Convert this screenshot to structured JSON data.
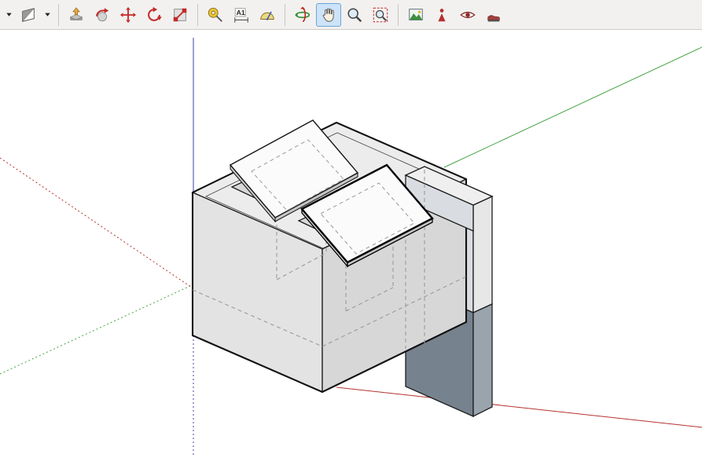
{
  "app": {
    "name": "SketchUp model window",
    "active_tool": "Pan"
  },
  "toolbar": {
    "background": "#f2f1ef",
    "dimensions_label": "A1",
    "buttons": [
      {
        "name": "style-dropdown",
        "icon": "dropdown-arrow-icon",
        "selected": false
      },
      {
        "name": "face-style",
        "icon": "face-style-swatch-icon",
        "selected": false
      },
      {
        "name": "face-style-dropdown",
        "icon": "dropdown-arrow-icon",
        "selected": false
      },
      {
        "name": "push-pull",
        "icon": "push-pull-icon",
        "selected": false
      },
      {
        "name": "follow-me",
        "icon": "follow-me-icon",
        "selected": false
      },
      {
        "name": "move",
        "icon": "move-icon",
        "selected": false
      },
      {
        "name": "rotate",
        "icon": "rotate-icon",
        "selected": false
      },
      {
        "name": "scale",
        "icon": "scale-icon",
        "selected": false
      },
      {
        "name": "tape-measure",
        "icon": "tape-measure-icon",
        "selected": false
      },
      {
        "name": "dimensions",
        "icon": "dimensions-icon",
        "selected": false,
        "label": "A1"
      },
      {
        "name": "protractor",
        "icon": "protractor-icon",
        "selected": false
      },
      {
        "name": "orbit",
        "icon": "orbit-icon",
        "selected": false
      },
      {
        "name": "pan",
        "icon": "pan-hand-icon",
        "selected": true
      },
      {
        "name": "zoom",
        "icon": "zoom-icon",
        "selected": false
      },
      {
        "name": "zoom-extents",
        "icon": "zoom-extents-icon",
        "selected": false
      },
      {
        "name": "match-photo",
        "icon": "match-photo-icon",
        "selected": false
      },
      {
        "name": "position-camera",
        "icon": "position-camera-icon",
        "selected": false
      },
      {
        "name": "look-around",
        "icon": "look-around-icon",
        "selected": false
      },
      {
        "name": "walk",
        "icon": "walk-icon",
        "selected": false
      }
    ]
  },
  "canvas": {
    "background": "#ffffff",
    "axes": {
      "red": "#b5322e",
      "green": "#46a546",
      "blue": "#3f3fae"
    },
    "model": {
      "top_face": "#ececec",
      "left_face": "#e3e3e3",
      "right_face": "#d7d7d7",
      "cavity": "#d8d8d8",
      "panel_face": "#fbfbfb",
      "panel_edge_light": "#d0d0d0",
      "panel_edge_dark": "#c6c6c6",
      "slab_upper": "#d9dde1",
      "slab_dark": "#76828e",
      "slab_side_upper": "#e7e7e7",
      "slab_side_dark": "#9aa4ad",
      "slab_top": "#efefef",
      "edge": "#1c1c1c",
      "hidden_edge": "#9b9b9b"
    }
  }
}
